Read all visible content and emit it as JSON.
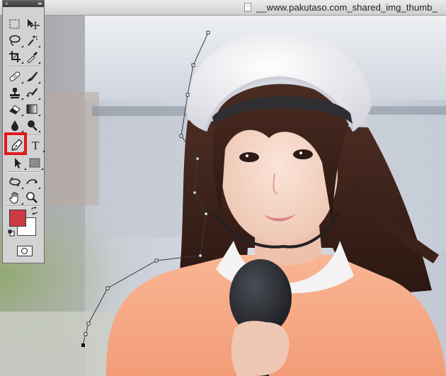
{
  "document": {
    "title": "__www.pakutaso.com_shared_img_thumb_",
    "file_icon": "document-icon"
  },
  "tools_panel": {
    "close_icon": "×",
    "collapse_icon": "▸▸",
    "tools": [
      {
        "name": "rectangular-marquee-tool",
        "icon": "marquee-icon"
      },
      {
        "name": "move-tool",
        "icon": "move-icon"
      },
      {
        "name": "lasso-tool",
        "icon": "lasso-icon"
      },
      {
        "name": "magic-wand-tool",
        "icon": "magic-wand-icon"
      },
      {
        "name": "crop-tool",
        "icon": "crop-icon"
      },
      {
        "name": "eyedropper-tool",
        "icon": "eyedropper-icon"
      },
      {
        "name": "healing-brush-tool",
        "icon": "bandage-icon"
      },
      {
        "name": "brush-tool",
        "icon": "brush-icon"
      },
      {
        "name": "clone-stamp-tool",
        "icon": "stamp-icon"
      },
      {
        "name": "history-brush-tool",
        "icon": "history-brush-icon"
      },
      {
        "name": "eraser-tool",
        "icon": "eraser-icon"
      },
      {
        "name": "gradient-tool",
        "icon": "gradient-icon"
      },
      {
        "name": "blur-tool",
        "icon": "drop-icon"
      },
      {
        "name": "dodge-tool",
        "icon": "dodge-icon"
      },
      {
        "name": "pen-tool",
        "icon": "pen-icon",
        "selected": true
      },
      {
        "name": "type-tool",
        "icon": "type-icon",
        "label": "T"
      },
      {
        "name": "path-selection-tool",
        "icon": "arrow-icon"
      },
      {
        "name": "rectangle-tool",
        "icon": "rectangle-icon"
      },
      {
        "name": "3d-rotate-tool",
        "icon": "3d-rotate-icon"
      },
      {
        "name": "3d-orbit-tool",
        "icon": "3d-orbit-icon"
      },
      {
        "name": "hand-tool",
        "icon": "hand-icon"
      },
      {
        "name": "zoom-tool",
        "icon": "zoom-icon"
      }
    ],
    "foreground_color": "#cc3b43",
    "background_color": "#ffffff",
    "highlight_color": "#e21a1a"
  }
}
